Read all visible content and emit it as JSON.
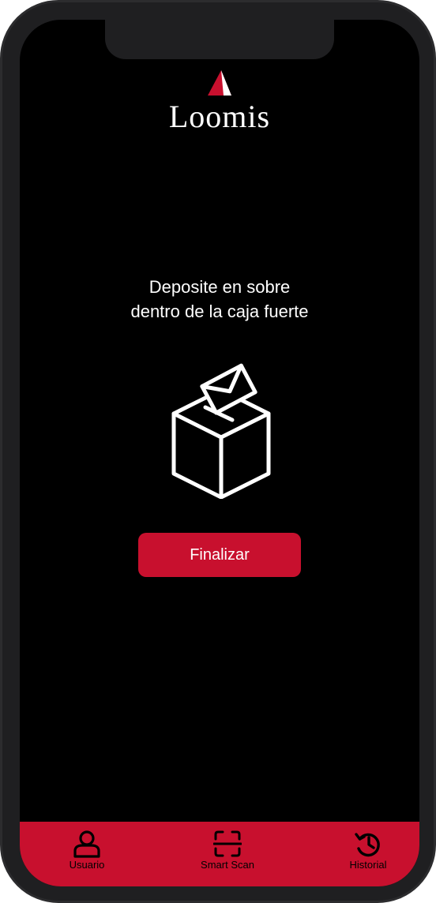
{
  "brand": {
    "name": "Loomis",
    "accent_color": "#c8102e"
  },
  "instruction": {
    "line1": "Deposite en sobre",
    "line2": "dentro de la caja fuerte"
  },
  "illustration": {
    "icon": "ballot-box-envelope-icon"
  },
  "actions": {
    "finish_label": "Finalizar"
  },
  "bottom_nav": {
    "items": [
      {
        "label": "Usuario",
        "icon": "user-icon"
      },
      {
        "label": "Smart Scan",
        "icon": "scan-icon"
      },
      {
        "label": "Historial",
        "icon": "history-icon"
      }
    ]
  }
}
